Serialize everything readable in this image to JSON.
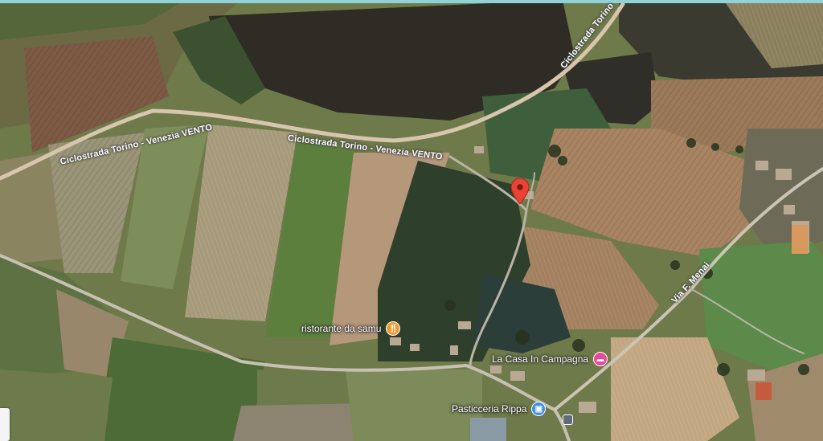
{
  "colors": {
    "restaurant": "#f19a35",
    "hotel": "#e8489a",
    "shop": "#3f8fe6",
    "pin": "#ea4335"
  },
  "roads": [
    {
      "name": "Ciclostrada Torino - Venezia VENTO"
    },
    {
      "name": "Ciclostrada Torino - Venezia VENTO"
    },
    {
      "name": "Ciclostrada Torino"
    },
    {
      "name": "Via F. Menai"
    }
  ],
  "pois": [
    {
      "name": "ristorante da samu",
      "category": "restaurant",
      "icon": "fork-knife-icon"
    },
    {
      "name": "La Casa In Campagna",
      "category": "hotel",
      "icon": "bed-icon"
    },
    {
      "name": "Pasticceria Rippa",
      "category": "shop",
      "icon": "shopping-bag-icon"
    }
  ],
  "marker": {
    "icon": "location-pin-icon"
  },
  "transit": {
    "icon": "bus-stop-icon"
  }
}
